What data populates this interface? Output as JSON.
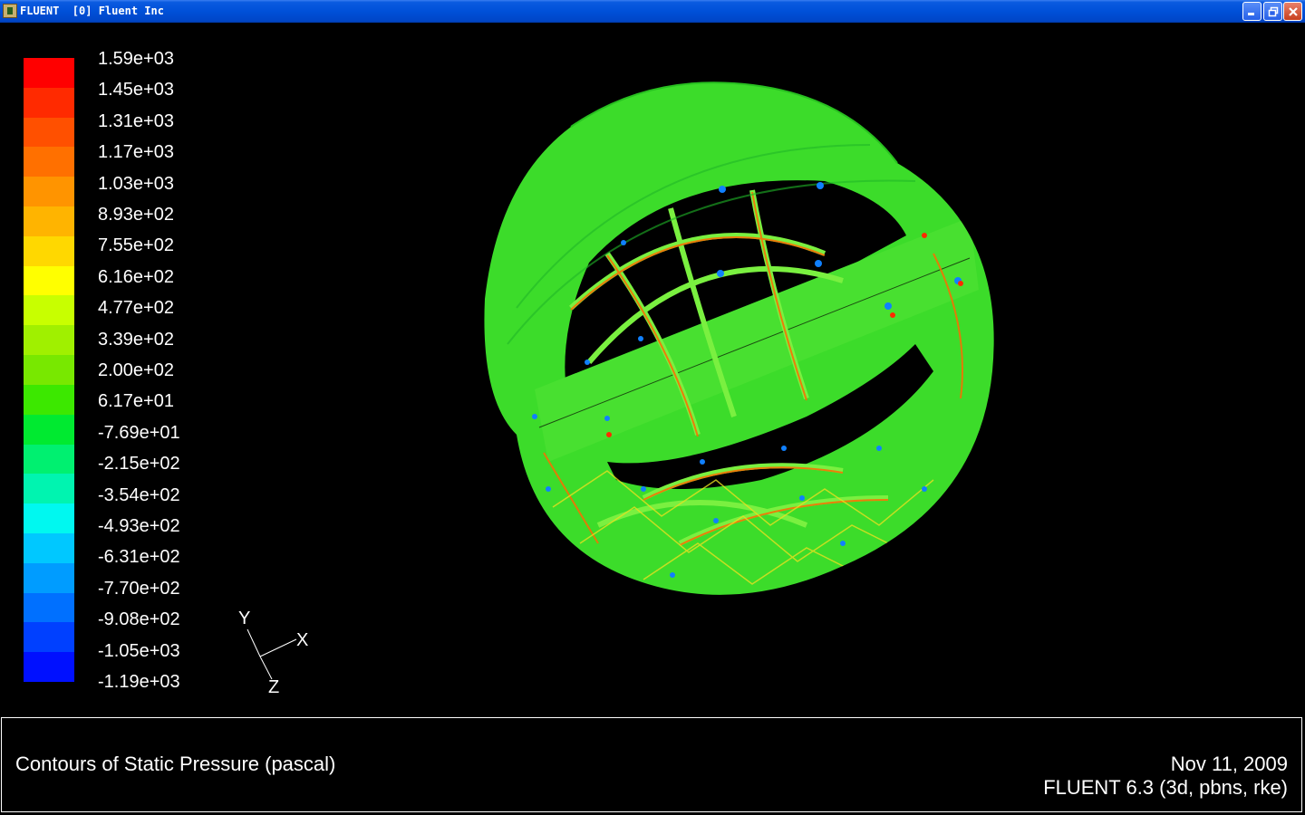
{
  "window": {
    "title": "FLUENT  [0] Fluent Inc",
    "minimize_icon": "minimize-icon",
    "maximize_icon": "restore-icon",
    "close_icon": "close-icon"
  },
  "colormap": {
    "labels": [
      "1.59e+03",
      "1.45e+03",
      "1.31e+03",
      "1.17e+03",
      "1.03e+03",
      "8.93e+02",
      "7.55e+02",
      "6.16e+02",
      "4.77e+02",
      "3.39e+02",
      "2.00e+02",
      "6.17e+01",
      "-7.69e+01",
      "-2.15e+02",
      "-3.54e+02",
      "-4.93e+02",
      "-6.31e+02",
      "-7.70e+02",
      "-9.08e+02",
      "-1.05e+03",
      "-1.19e+03"
    ],
    "colors": [
      "#ff0000",
      "#ff2a00",
      "#ff5000",
      "#ff7000",
      "#ff9400",
      "#ffb400",
      "#ffd800",
      "#ffff00",
      "#c8ff00",
      "#a0f000",
      "#78e800",
      "#3ce800",
      "#00ea30",
      "#00f070",
      "#00f4b0",
      "#00f8f0",
      "#00c8ff",
      "#009cff",
      "#0070ff",
      "#0040ff",
      "#0010ff"
    ]
  },
  "axes": {
    "x": "X",
    "y": "Y",
    "z": "Z"
  },
  "info": {
    "title": "Contours of Static Pressure (pascal)",
    "date": "Nov 11, 2009",
    "version": "FLUENT 6.3 (3d, pbns, rke)"
  }
}
